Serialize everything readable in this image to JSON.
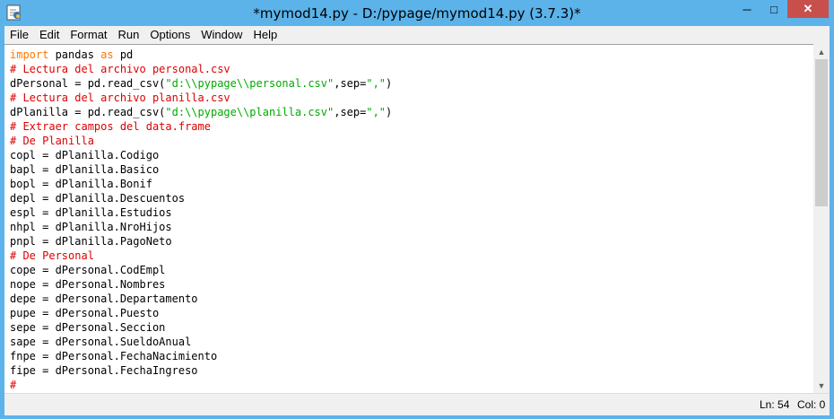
{
  "window": {
    "title": "*mymod14.py - D:/pypage/mymod14.py (3.7.3)*",
    "controls": {
      "minimize": "─",
      "maximize": "□",
      "close": "✕"
    }
  },
  "menubar": {
    "items": [
      "File",
      "Edit",
      "Format",
      "Run",
      "Options",
      "Window",
      "Help"
    ]
  },
  "editor": {
    "lines": [
      [
        {
          "t": "import",
          "c": "kw"
        },
        {
          "t": " pandas "
        },
        {
          "t": "as",
          "c": "kw"
        },
        {
          "t": " pd"
        }
      ],
      [
        {
          "t": "# Lectura del archivo personal.csv",
          "c": "cm"
        }
      ],
      [
        {
          "t": "dPersonal = pd.read_csv("
        },
        {
          "t": "\"d:\\\\pypage\\\\personal.csv\"",
          "c": "st"
        },
        {
          "t": ",sep="
        },
        {
          "t": "\",\"",
          "c": "st"
        },
        {
          "t": ")"
        }
      ],
      [
        {
          "t": "# Lectura del archivo planilla.csv",
          "c": "cm"
        }
      ],
      [
        {
          "t": "dPlanilla = pd.read_csv("
        },
        {
          "t": "\"d:\\\\pypage\\\\planilla.csv\"",
          "c": "st"
        },
        {
          "t": ",sep="
        },
        {
          "t": "\",\"",
          "c": "st"
        },
        {
          "t": ")"
        }
      ],
      [
        {
          "t": "# Extraer campos del data.frame",
          "c": "cm"
        }
      ],
      [
        {
          "t": "# De Planilla",
          "c": "cm"
        }
      ],
      [
        {
          "t": "copl = dPlanilla.Codigo"
        }
      ],
      [
        {
          "t": "bapl = dPlanilla.Basico"
        }
      ],
      [
        {
          "t": "bopl = dPlanilla.Bonif"
        }
      ],
      [
        {
          "t": "depl = dPlanilla.Descuentos"
        }
      ],
      [
        {
          "t": "espl = dPlanilla.Estudios"
        }
      ],
      [
        {
          "t": "nhpl = dPlanilla.NroHijos"
        }
      ],
      [
        {
          "t": "pnpl = dPlanilla.PagoNeto"
        }
      ],
      [
        {
          "t": "# De Personal",
          "c": "cm"
        }
      ],
      [
        {
          "t": "cope = dPersonal.CodEmpl"
        }
      ],
      [
        {
          "t": "nope = dPersonal.Nombres"
        }
      ],
      [
        {
          "t": "depe = dPersonal.Departamento"
        }
      ],
      [
        {
          "t": "pupe = dPersonal.Puesto"
        }
      ],
      [
        {
          "t": "sepe = dPersonal.Seccion"
        }
      ],
      [
        {
          "t": "sape = dPersonal.SueldoAnual"
        }
      ],
      [
        {
          "t": "fnpe = dPersonal.FechaNacimiento"
        }
      ],
      [
        {
          "t": "fipe = dPersonal.FechaIngreso"
        }
      ],
      [
        {
          "t": "#",
          "c": "cm"
        }
      ]
    ]
  },
  "colors": {
    "keyword": "#ff7700",
    "comment": "#dd0000",
    "string": "#00aa00",
    "titlebar": "#5bb3ea",
    "close_button": "#c7504c"
  },
  "statusbar": {
    "line": "Ln: 54",
    "col": "Col: 0"
  }
}
